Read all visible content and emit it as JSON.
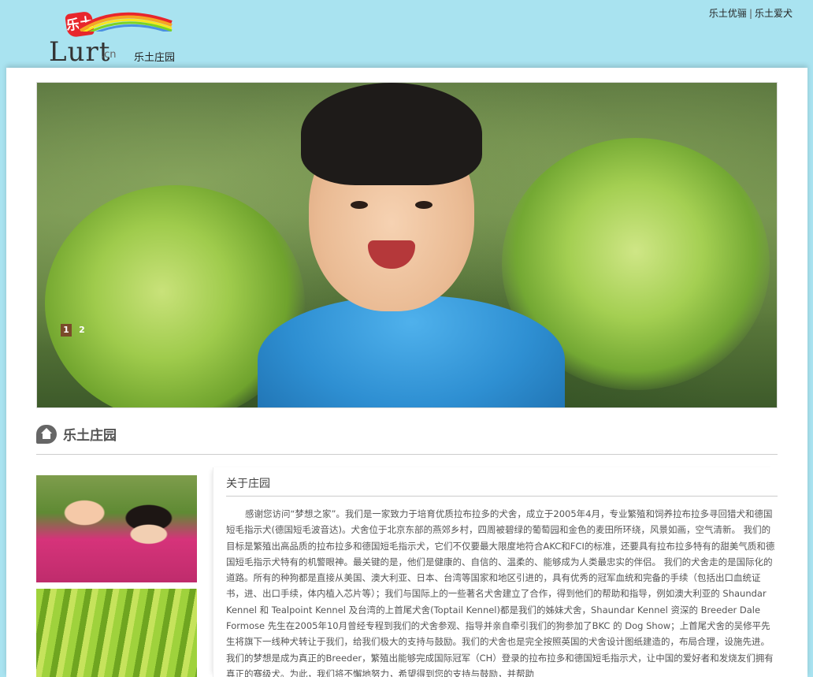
{
  "header": {
    "logo_text": "Lurt",
    "logo_domain": ".cn",
    "logo_badge": "乐土",
    "logo_subtitle": "乐土庄园",
    "links": [
      "乐土优骊",
      "乐土爱犬"
    ],
    "link_separator": "|"
  },
  "banner": {
    "slides": [
      "1",
      "2"
    ],
    "active_slide": 1
  },
  "section": {
    "title": "乐土庄园"
  },
  "article": {
    "title": "关于庄园",
    "body": "感谢您访问“梦想之家”。我们是一家致力于培育优质拉布拉多的犬舍，成立于2005年4月，专业繁殖和饲养拉布拉多寻回猎犬和德国短毛指示犬(德国短毛波音达)。犬舍位于北京东部的燕郊乡村，四周被碧绿的葡萄园和金色的麦田所环绕，风景如画，空气清新。 我们的目标是繁殖出高品质的拉布拉多和德国短毛指示犬，它们不仅要最大限度地符合AKC和FCI的标准，还要具有拉布拉多特有的甜美气质和德国短毛指示犬特有的机警眼神。最关键的是，他们是健康的、自信的、温柔的、能够成为人类最忠实的伴侣。 我们的犬舍走的是国际化的道路。所有的种狗都是直接从美国、澳大利亚、日本、台湾等国家和地区引进的，具有优秀的冠军血统和完备的手续（包括出口血统证书，进、出口手续，体内植入芯片等）；我们与国际上的一些著名犬舍建立了合作，得到他们的帮助和指导，例如澳大利亚的 Shaundar Kennel 和 Tealpoint Kennel 及台湾的上首尾犬舍(Toptail Kennel)都是我们的姊妹犬舍，Shaundar Kennel 资深的 Breeder Dale Formose 先生在2005年10月曾经专程到我们的犬舍参观、指导并亲自牵引我们的狗参加了BKC 的 Dog Show；上首尾犬舍的吴修平先生将旗下一线种犬转让于我们，给我们极大的支持与鼓励。我们的犬舍也是完全按照英国的犬舍设计图纸建造的，布局合理，设施先进。我们的梦想是成为真正的Breeder，繁殖出能够完成国际冠军（CH）登录的拉布拉多和德国短毛指示犬，让中国的爱好者和发烧友们拥有真正的赛级犬。为此，我们将不懈地努力，希望得到您的支持与鼓励，并帮助"
  },
  "colors": {
    "page_bg": "#a9e3f0",
    "active_dot": "#7a4a2a"
  }
}
